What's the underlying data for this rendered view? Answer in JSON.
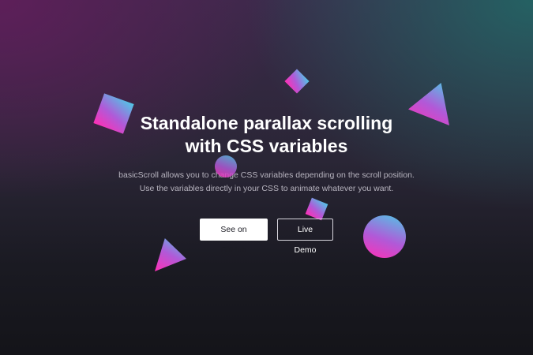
{
  "hero": {
    "title_line1": "Standalone parallax scrolling",
    "title_line2": "with CSS variables",
    "subtitle_line1": "basicScroll allows you to change CSS variables depending on the scroll position.",
    "subtitle_line2": "Use the variables directly in your CSS to animate whatever you want."
  },
  "buttons": {
    "github_label": "See on GitHub",
    "demo_label": "Live Demo"
  },
  "colors": {
    "gradient_start": "#4fc7e6",
    "gradient_mid": "#b05ad8",
    "gradient_end": "#ff2fb5",
    "title_text": "#ffffff",
    "subtitle_text": "#b7b4bf"
  }
}
